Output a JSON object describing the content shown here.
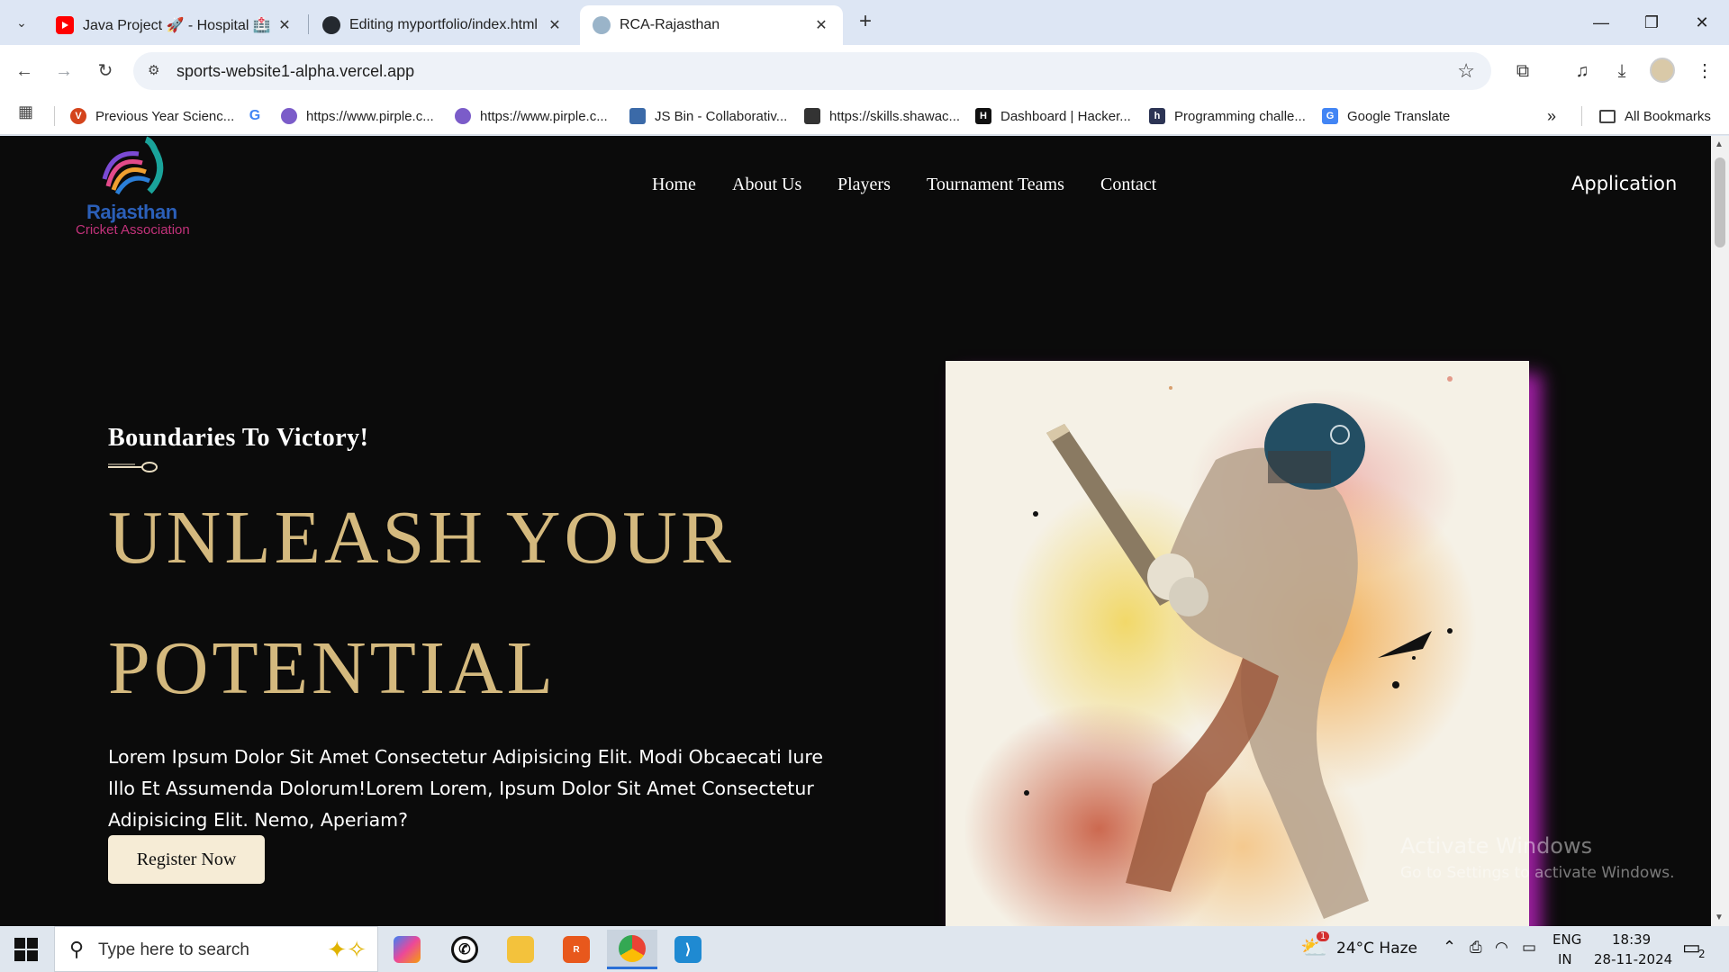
{
  "browser": {
    "tabs": [
      {
        "title": "Java Project 🚀 - Hospital 🏥",
        "favicon": "youtube-icon",
        "color": "#ff0000"
      },
      {
        "title": "Editing myportfolio/index.html",
        "favicon": "github-icon",
        "color": "#24292f"
      },
      {
        "title": "RCA-Rajasthan",
        "favicon": "rca-icon",
        "color": "#9ab4c9"
      }
    ],
    "url": "sports-website1-alpha.vercel.app",
    "bookmarks": [
      {
        "label": "Previous Year Scienc...",
        "icon": "v-icon",
        "color": "#d4441c"
      },
      {
        "label": "",
        "icon": "google-icon",
        "color": "#4285f4"
      },
      {
        "label": "https://www.pirple.c...",
        "icon": "pirple-icon",
        "color": "#7b5cc9"
      },
      {
        "label": "https://www.pirple.c...",
        "icon": "pirple-icon",
        "color": "#7b5cc9"
      },
      {
        "label": "JS Bin - Collaborativ...",
        "icon": "jsbin-icon",
        "color": "#3b6aa8"
      },
      {
        "label": "https://skills.shawac...",
        "icon": "shawac-icon",
        "color": "#333333"
      },
      {
        "label": "Dashboard | Hacker...",
        "icon": "hackerrank-icon",
        "color": "#111111"
      },
      {
        "label": "Programming challe...",
        "icon": "hackerearth-icon",
        "color": "#2c3454"
      },
      {
        "label": "Google Translate",
        "icon": "translate-icon",
        "color": "#4285f4"
      }
    ],
    "all_bookmarks": "All Bookmarks"
  },
  "site": {
    "logo_line1": "Rajasthan",
    "logo_line2": "Cricket Association",
    "nav": [
      "Home",
      "About Us",
      "Players",
      "Tournament Teams",
      "Contact"
    ],
    "apply": "Application",
    "tagline": "Boundaries To Victory!",
    "headline_line1": "UNLEASH YOUR",
    "headline_line2": "POTENTIAL",
    "lead": "Lorem Ipsum Dolor Sit Amet Consectetur Adipisicing Elit. Modi Obcaecati Iure Illo Et Assumenda Dolorum!Lorem Lorem, Ipsum Dolor Sit Amet Consectetur Adipisicing Elit. Nemo, Aperiam?",
    "register": "Register Now",
    "accent": "#d4b97e",
    "shadow": "#9b1e9f"
  },
  "watermark": {
    "line1": "Activate Windows",
    "line2": "Go to Settings to activate Windows."
  },
  "taskbar": {
    "search_placeholder": "Type here to search",
    "weather": "24°C  Haze",
    "weather_badge": "1",
    "lang1": "ENG",
    "lang2": "IN",
    "time": "18:39",
    "date": "28-11-2024",
    "notification_count": "2"
  }
}
